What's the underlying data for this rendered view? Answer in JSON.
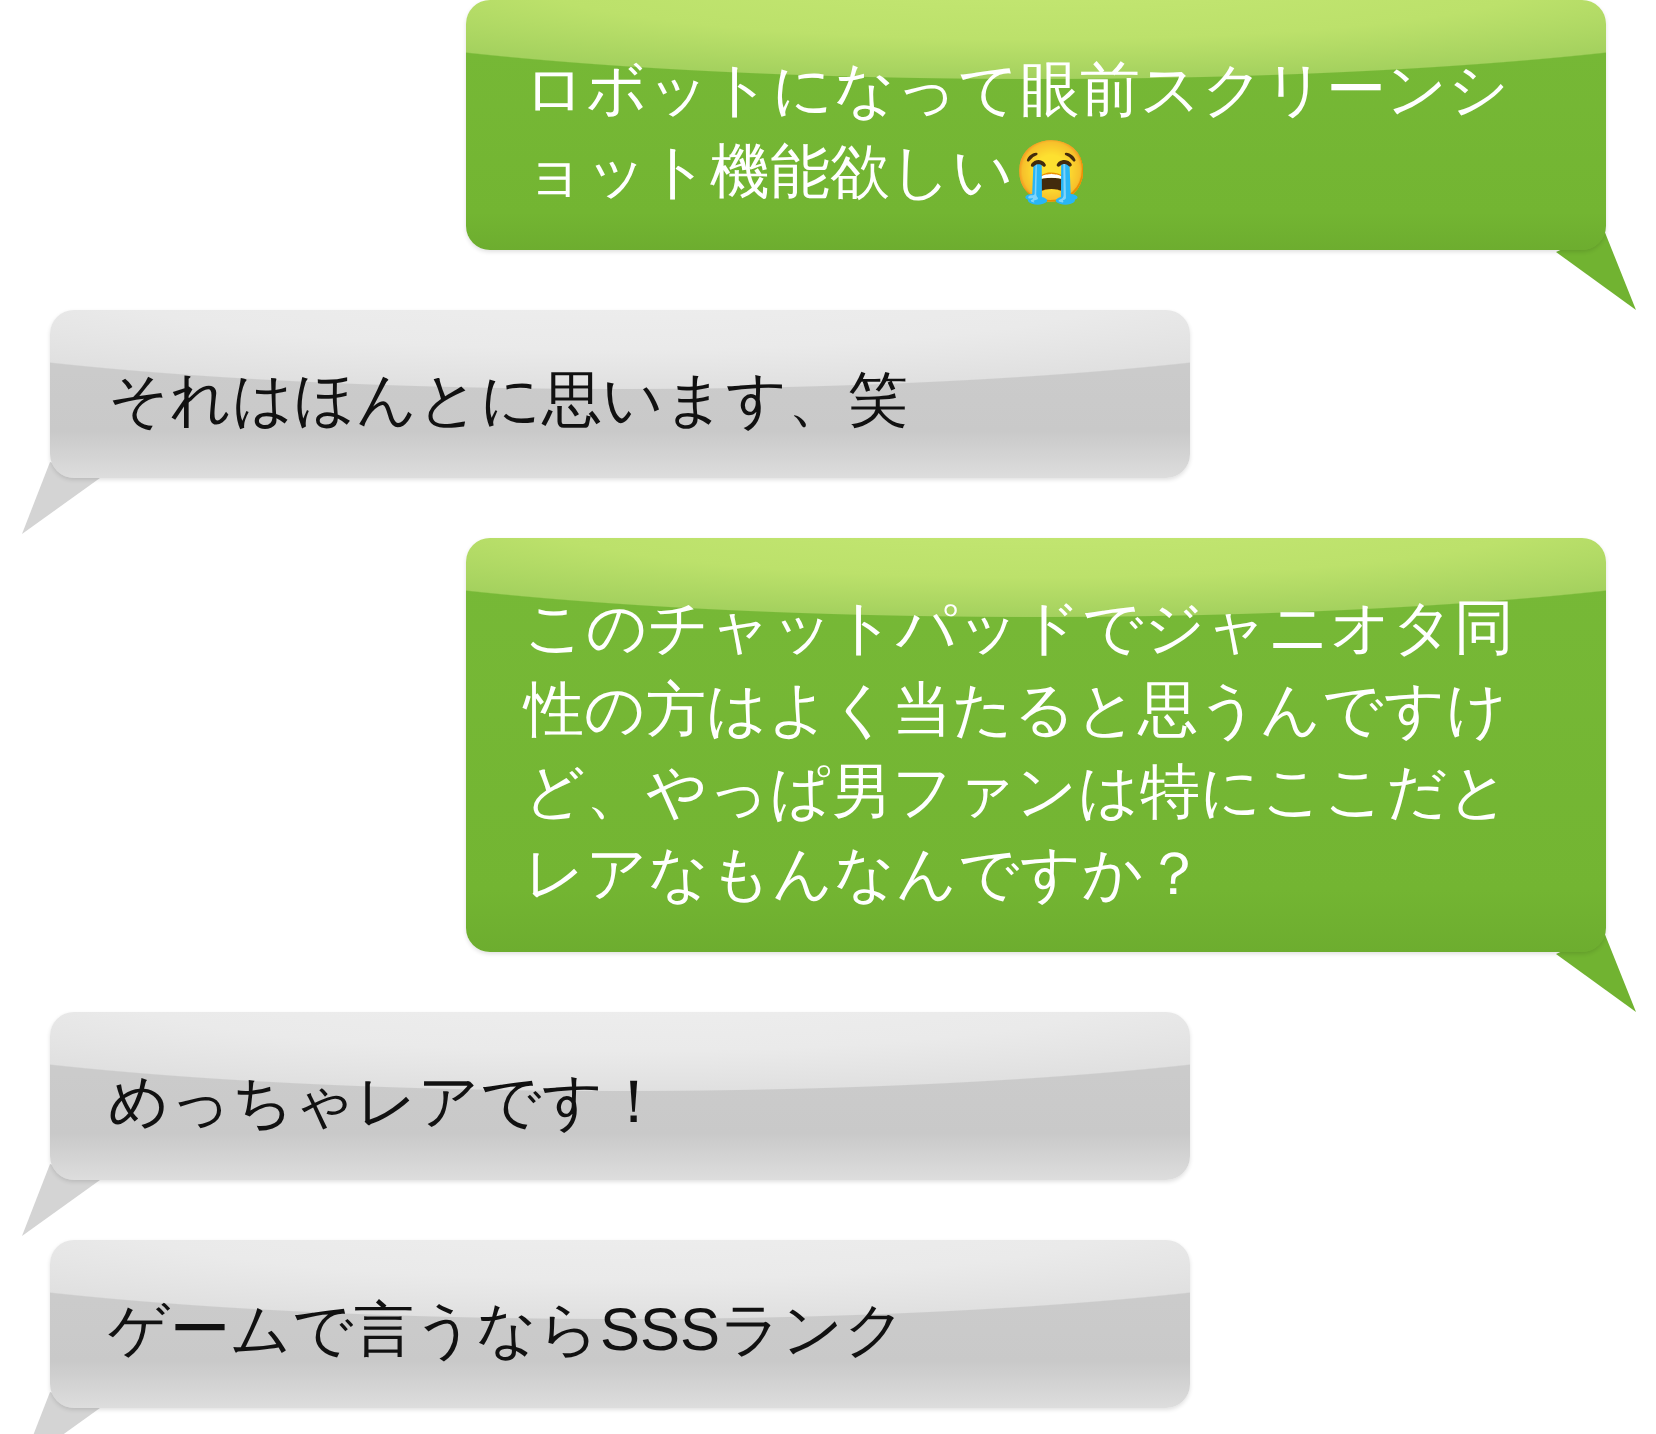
{
  "messages": [
    {
      "kind": "sent",
      "text": "ロボットになって眼前スクリーンショット機能欲しい😭"
    },
    {
      "kind": "received",
      "text": "それはほんとに思います、笑"
    },
    {
      "kind": "sent",
      "text": "このチャットパッドでジャニオタ同性の方はよく当たると思うんですけど、やっぱ男ファンは特にここだとレアなもんなんですか？"
    },
    {
      "kind": "received",
      "text": "めっちゃレアです！"
    },
    {
      "kind": "received",
      "text": "ゲームで言うならSSSランク"
    }
  ]
}
